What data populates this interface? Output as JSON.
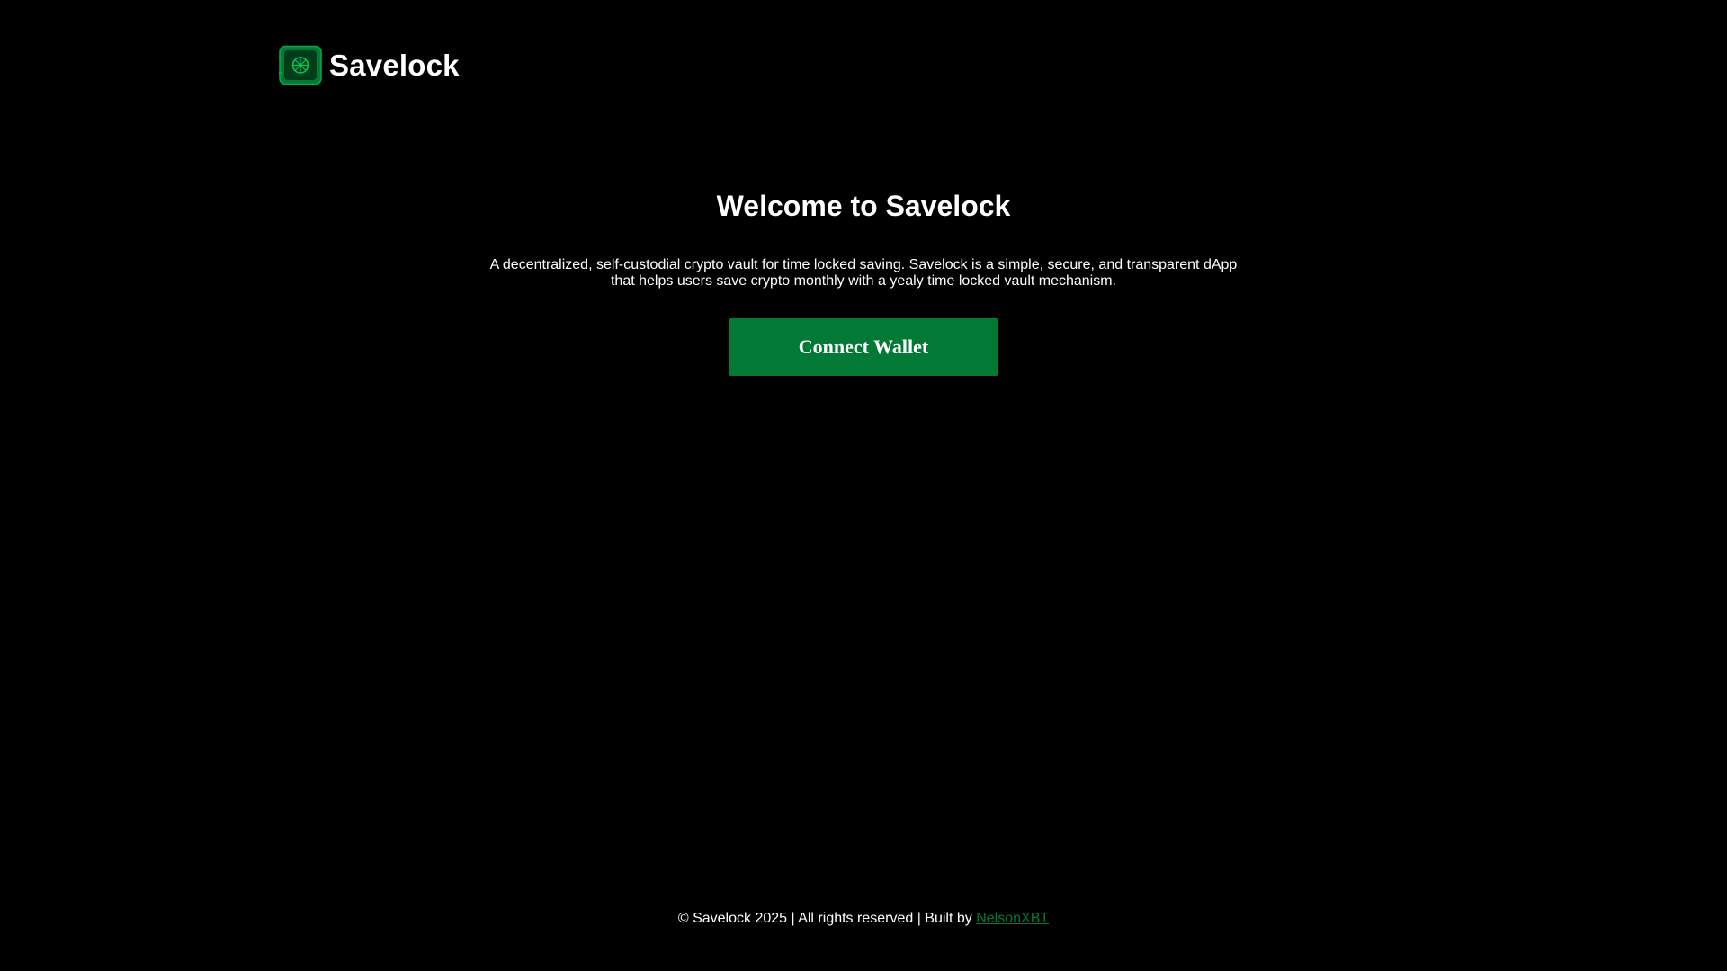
{
  "header": {
    "logo_icon": "vault-safe-icon",
    "brand_name": "Savelock"
  },
  "hero": {
    "title": "Welcome to Savelock",
    "description": "A decentralized, self-custodial crypto vault for time locked saving. Savelock is a simple, secure, and transparent dApp that helps users save crypto monthly with a yealy time locked vault mechanism.",
    "connect_label": "Connect Wallet"
  },
  "footer": {
    "text": "© Savelock 2025 | All rights reserved | Built by ",
    "author_link": "NelsonXBT"
  },
  "colors": {
    "accent": "#027a36",
    "background": "#000000",
    "text": "#ffffff"
  }
}
